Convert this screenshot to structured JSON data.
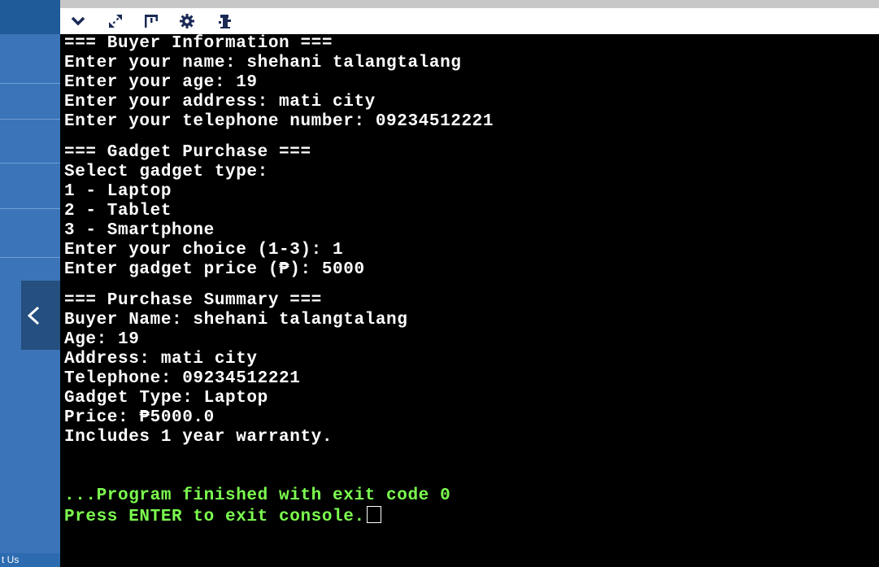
{
  "sidebar": {
    "bottom_label": "t Us"
  },
  "toolbar": {
    "icons": [
      "chevron-down-icon",
      "expand-icon",
      "window-icon",
      "gear-icon",
      "debug-icon"
    ]
  },
  "console": {
    "buyer_info": {
      "header": "=== Buyer Information ===",
      "name_line": "Enter your name: shehani talangtalang",
      "age_line": "Enter your age: 19",
      "address_line": "Enter your address: mati city",
      "phone_line": "Enter your telephone number: 09234512221"
    },
    "gadget_purchase": {
      "header": "=== Gadget Purchase ===",
      "select_line": "Select gadget type:",
      "option_1": "1 - Laptop",
      "option_2": "2 - Tablet",
      "option_3": "3 - Smartphone",
      "choice_line": "Enter your choice (1-3): 1",
      "price_line": "Enter gadget price (₱): 5000"
    },
    "summary": {
      "header": "=== Purchase Summary ===",
      "buyer_name": "Buyer Name: shehani talangtalang",
      "age": "Age: 19",
      "address": "Address: mati city",
      "telephone": "Telephone: 09234512221",
      "gadget_type": "Gadget Type: Laptop",
      "price": "Price: ₱5000.0",
      "warranty": "Includes 1 year warranty."
    },
    "exit_message": "...Program finished with exit code 0",
    "press_enter": "Press ENTER to exit console."
  },
  "colors": {
    "sidebar": "#3b74b8",
    "console_bg": "#000000",
    "console_text": "#ffffff",
    "exit_text": "#7cff4f"
  }
}
